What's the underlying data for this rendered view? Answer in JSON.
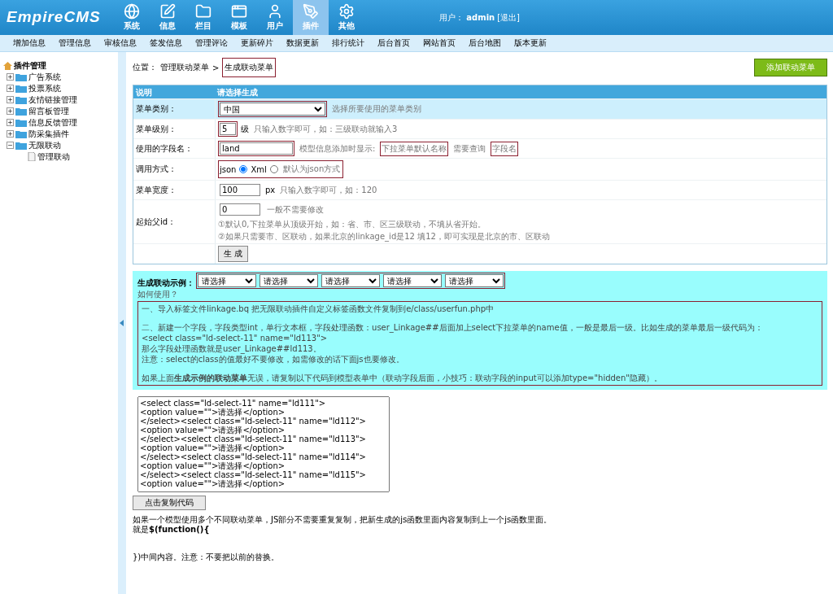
{
  "header": {
    "logo": "EmpireCMS",
    "nav": [
      {
        "label": "系统",
        "selected": false
      },
      {
        "label": "信息",
        "selected": false
      },
      {
        "label": "栏目",
        "selected": false
      },
      {
        "label": "模板",
        "selected": false
      },
      {
        "label": "用户",
        "selected": false
      },
      {
        "label": "插件",
        "selected": true
      },
      {
        "label": "其他",
        "selected": false
      }
    ],
    "user_label": "用户：",
    "user_name": "admin",
    "logout": "[退出]"
  },
  "submenu": [
    "增加信息",
    "管理信息",
    "审核信息",
    "签发信息",
    "管理评论",
    "更新碎片",
    "数据更新",
    "排行统计",
    "后台首页",
    "网站首页",
    "后台地图",
    "版本更新"
  ],
  "sidebar": {
    "title": "插件管理",
    "items": [
      {
        "label": "广告系统",
        "expanded": false
      },
      {
        "label": "投票系统",
        "expanded": false
      },
      {
        "label": "友情链接管理",
        "expanded": false
      },
      {
        "label": "留言板管理",
        "expanded": false
      },
      {
        "label": "信息反馈管理",
        "expanded": false
      },
      {
        "label": "防采集插件",
        "expanded": false
      },
      {
        "label": "无限联动",
        "expanded": true,
        "children": [
          {
            "label": "管理联动"
          }
        ]
      }
    ]
  },
  "breadcrumb": {
    "label": "位置：",
    "parent": "管理联动菜单",
    "separator": ">",
    "current": "生成联动菜单",
    "highlighted": true
  },
  "add_button": "添加联动菜单",
  "form": {
    "columns": [
      "说明",
      "请选择生成"
    ],
    "rows": [
      {
        "kind": "select",
        "label": "菜单类别：",
        "value": "中国",
        "highlighted": true,
        "hints": [
          {
            "text": "选择所要使用的菜单类别",
            "highlighted": false
          }
        ]
      },
      {
        "kind": "input",
        "label": "菜单级别：",
        "value": "5",
        "highlighted": true,
        "suffix": "级",
        "hints": [
          {
            "text": "只输入数字即可，如：三级联动就输入3",
            "highlighted": false
          }
        ]
      },
      {
        "kind": "input",
        "label": "使用的字段名：",
        "value": "land",
        "highlighted": true,
        "wide": true,
        "hints": [
          {
            "text": "模型信息添加时显示:",
            "highlighted": false
          },
          {
            "text": "下拉菜单默认名称",
            "highlighted": true
          },
          {
            "text": "需要查询",
            "highlighted": false
          },
          {
            "text": "字段名",
            "highlighted": true
          }
        ]
      },
      {
        "kind": "radio",
        "label": "调用方式：",
        "highlighted": true,
        "options": [
          {
            "label": "json",
            "selected": true
          },
          {
            "label": "Xml",
            "selected": false
          }
        ],
        "hints": [
          {
            "text": "默认为json方式",
            "highlighted": false
          }
        ]
      },
      {
        "kind": "input",
        "label": "菜单宽度：",
        "value": "100",
        "highlighted": false,
        "suffix": "px",
        "hints": [
          {
            "text": "只输入数字即可，如：120",
            "highlighted": false
          }
        ]
      },
      {
        "kind": "input",
        "label": "起始父id：",
        "value": "0",
        "highlighted": false,
        "hints": [
          {
            "text": "一般不需要修改",
            "highlighted": false
          }
        ],
        "notes": [
          "①默认0,下拉菜单从顶级开始，如：省、市、区三级联动，不填从省开始。",
          "②如果只需要市、区联动，如果北京的linkage_id是12 填12，即可实现是北京的市、区联动"
        ]
      },
      {
        "kind": "button",
        "label": "",
        "value": "生 成"
      }
    ]
  },
  "example": {
    "title": "生成联动示例：",
    "selects": [
      "请选择",
      "请选择",
      "请选择",
      "请选择",
      "请选择"
    ],
    "highlighted": true,
    "help": "如何使用？",
    "instructions": {
      "highlighted": true,
      "paragraphs": [
        [
          "一、导入标签文件linkage.bq 把无限联动插件自定义标签函数文件复制到e/class/userfun.php中"
        ],
        [
          "二、新建一个字段，字段类型int，单行文本框，字段处理函数：user_Linkage##后面加上select下拉菜单的name值，一般是最后一级。比如生成的菜单最后一级代码为：",
          "<select class=\"ld-select-11\" name=\"ld113\">",
          "那么字段处理函数就是user_Linkage##ld113。",
          "注意：select的class的值最好不要修改，如需修改的话下面js也要修改。"
        ],
        [
          "如果上面**生成示例的联动菜单**无误，请复制以下代码到模型表单中（联动字段后面，小技巧：联动字段的input可以添加type=\"hidden\"隐藏）。"
        ]
      ]
    }
  },
  "code_box": {
    "lines": [
      "<select class=\"ld-select-11\" name=\"ld111\">",
      "<option value=\"\">请选择</option>",
      "</select><select class=\"ld-select-11\" name=\"ld112\">",
      "<option value=\"\">请选择</option>",
      "</select><select class=\"ld-select-11\" name=\"ld113\">",
      "<option value=\"\">请选择</option>",
      "</select><select class=\"ld-select-11\" name=\"ld114\">",
      "<option value=\"\">请选择</option>",
      "</select><select class=\"ld-select-11\" name=\"ld115\">",
      "<option value=\"\">请选择</option>"
    ]
  },
  "copy_button": "点击复制代码",
  "footer_notes": [
    [
      "如果一个模型使用多个不同联动菜单，JS部分不需要重复复制，把新生成的js函数里面内容复制到上一个js函数里面。",
      "就是**$(function(){**"
    ],
    [
      "})中间内容。注意：不要把以前的替换。"
    ]
  ]
}
